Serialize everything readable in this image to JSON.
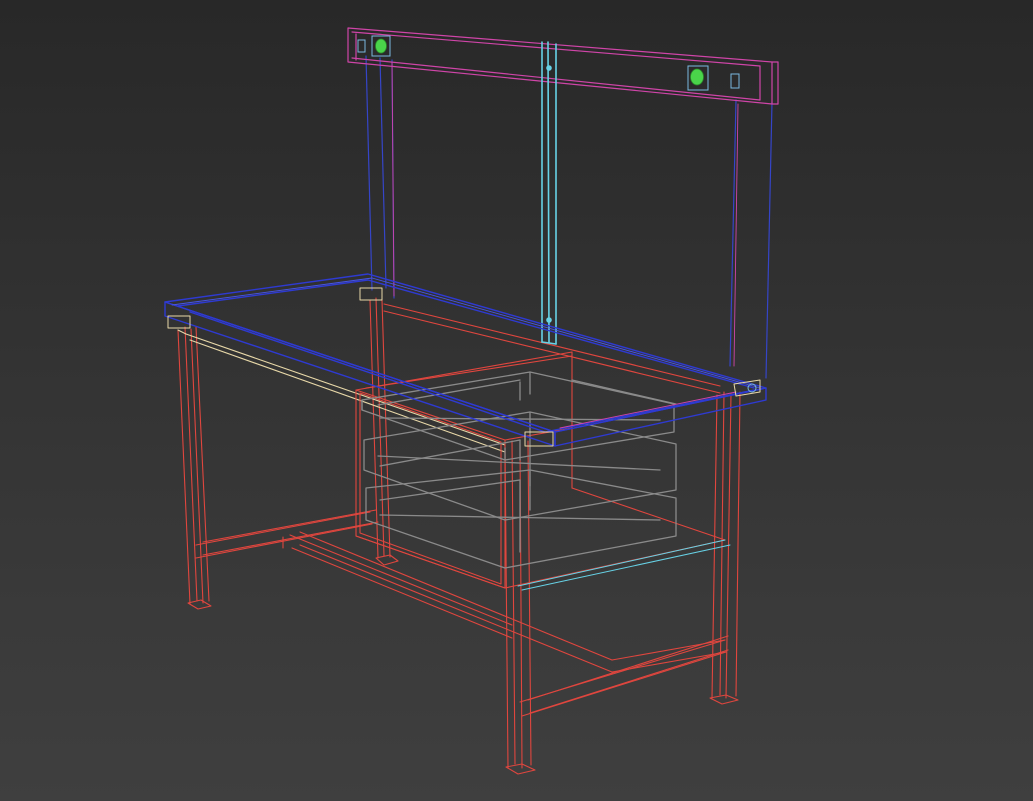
{
  "viewport": {
    "background": "#2e2e2e",
    "render_mode": "wireframe"
  },
  "colors": {
    "frame": "#e0463e",
    "frame_dark": "#b8322c",
    "top": "#2e3ad2",
    "top_light": "#4856e8",
    "backpanel": "#3545c8",
    "rail": "#cf45a8",
    "post": "#67d2e6",
    "drawers": "#8a8a8a",
    "trim": "#e8d8a8",
    "outlet": "#4ad44a",
    "switch": "#7ab8e0"
  },
  "objects": [
    {
      "name": "workbench-frame",
      "type": "legs-and-stretchers"
    },
    {
      "name": "worktop",
      "type": "box"
    },
    {
      "name": "back-panel",
      "type": "panel"
    },
    {
      "name": "power-rail",
      "type": "box"
    },
    {
      "name": "center-post",
      "type": "box"
    },
    {
      "name": "drawer-cabinet",
      "type": "cabinet"
    },
    {
      "name": "drawers",
      "type": "drawer",
      "count": 3
    }
  ]
}
